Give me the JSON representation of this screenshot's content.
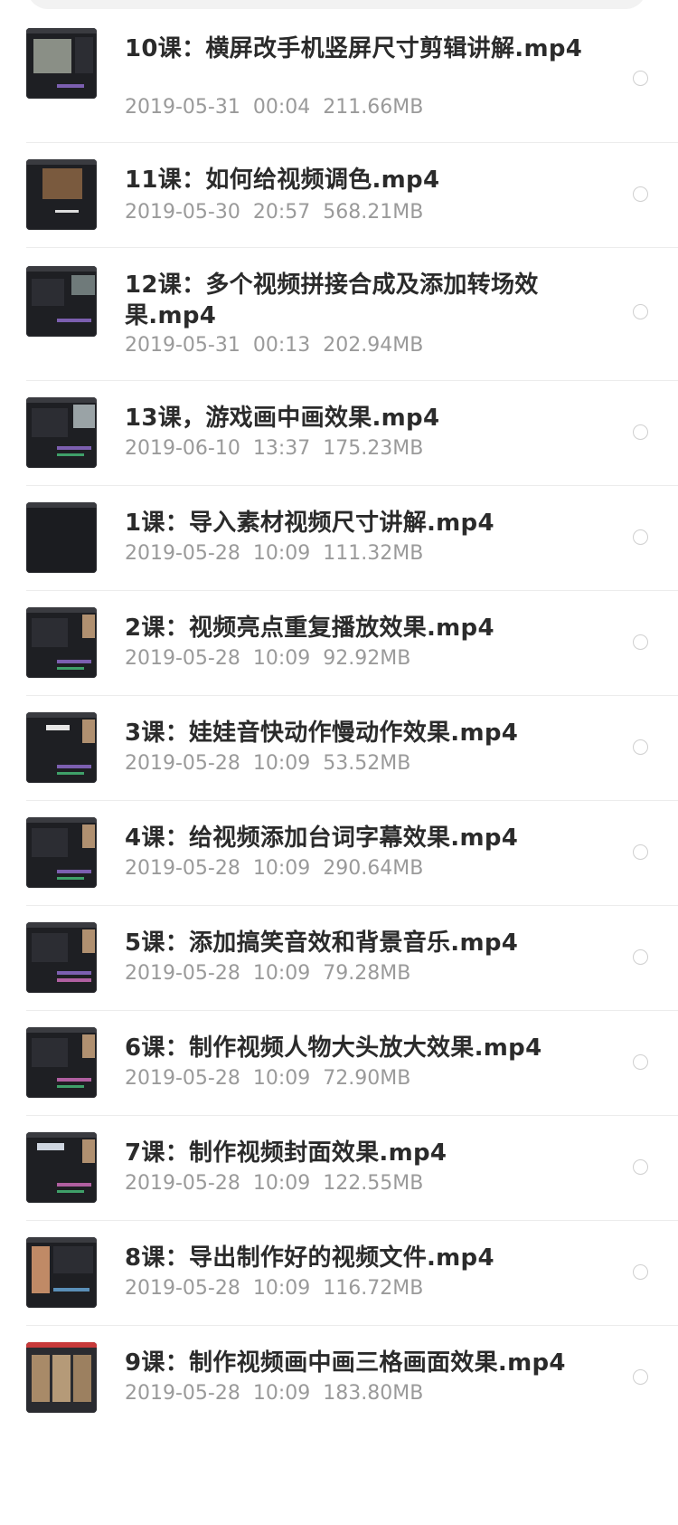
{
  "files": [
    {
      "title": "10课：横屏改手机竖屏尺寸剪辑讲解.mp4",
      "date": "2019-05-31",
      "time": "00:04",
      "size": "211.66MB",
      "thumb": "icon-video-thumbnail"
    },
    {
      "title": "11课：如何给视频调色.mp4",
      "date": "2019-05-30",
      "time": "20:57",
      "size": "568.21MB",
      "thumb": "icon-video-thumbnail"
    },
    {
      "title": "12课：多个视频拼接合成及添加转场效果.mp4",
      "date": "2019-05-31",
      "time": "00:13",
      "size": "202.94MB",
      "thumb": "icon-video-thumbnail"
    },
    {
      "title": "13课，游戏画中画效果.mp4",
      "date": "2019-06-10",
      "time": "13:37",
      "size": "175.23MB",
      "thumb": "icon-video-thumbnail"
    },
    {
      "title": "1课：导入素材视频尺寸讲解.mp4",
      "date": "2019-05-28",
      "time": "10:09",
      "size": "111.32MB",
      "thumb": "icon-video-thumbnail"
    },
    {
      "title": "2课：视频亮点重复播放效果.mp4",
      "date": "2019-05-28",
      "time": "10:09",
      "size": "92.92MB",
      "thumb": "icon-video-thumbnail"
    },
    {
      "title": "3课：娃娃音快动作慢动作效果.mp4",
      "date": "2019-05-28",
      "time": "10:09",
      "size": "53.52MB",
      "thumb": "icon-video-thumbnail"
    },
    {
      "title": "4课：给视频添加台词字幕效果.mp4",
      "date": "2019-05-28",
      "time": "10:09",
      "size": "290.64MB",
      "thumb": "icon-video-thumbnail"
    },
    {
      "title": "5课：添加搞笑音效和背景音乐.mp4",
      "date": "2019-05-28",
      "time": "10:09",
      "size": "79.28MB",
      "thumb": "icon-video-thumbnail"
    },
    {
      "title": "6课：制作视频人物大头放大效果.mp4",
      "date": "2019-05-28",
      "time": "10:09",
      "size": "72.90MB",
      "thumb": "icon-video-thumbnail"
    },
    {
      "title": "7课：制作视频封面效果.mp4",
      "date": "2019-05-28",
      "time": "10:09",
      "size": "122.55MB",
      "thumb": "icon-video-thumbnail"
    },
    {
      "title": "8课：导出制作好的视频文件.mp4",
      "date": "2019-05-28",
      "time": "10:09",
      "size": "116.72MB",
      "thumb": "icon-video-thumbnail"
    },
    {
      "title": "9课：制作视频画中画三格画面效果.mp4",
      "date": "2019-05-28",
      "time": "10:09",
      "size": "183.80MB",
      "thumb": "icon-video-thumbnail"
    }
  ],
  "colors": {
    "title": "#2b2b2b",
    "meta": "#9a9a9a",
    "divider": "#ececec",
    "radio_border": "#cfcfcf"
  }
}
